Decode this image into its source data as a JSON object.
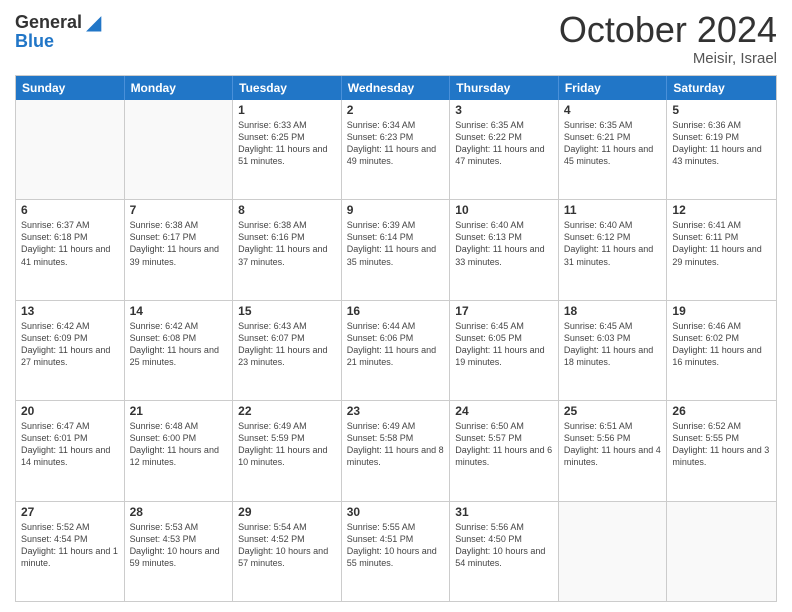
{
  "header": {
    "logo_general": "General",
    "logo_blue": "Blue",
    "month_title": "October 2024",
    "location": "Meisir, Israel"
  },
  "days_of_week": [
    "Sunday",
    "Monday",
    "Tuesday",
    "Wednesday",
    "Thursday",
    "Friday",
    "Saturday"
  ],
  "weeks": [
    [
      {
        "day": "",
        "sunrise": "",
        "sunset": "",
        "daylight": "",
        "empty": true
      },
      {
        "day": "",
        "sunrise": "",
        "sunset": "",
        "daylight": "",
        "empty": true
      },
      {
        "day": "1",
        "sunrise": "Sunrise: 6:33 AM",
        "sunset": "Sunset: 6:25 PM",
        "daylight": "Daylight: 11 hours and 51 minutes.",
        "empty": false
      },
      {
        "day": "2",
        "sunrise": "Sunrise: 6:34 AM",
        "sunset": "Sunset: 6:23 PM",
        "daylight": "Daylight: 11 hours and 49 minutes.",
        "empty": false
      },
      {
        "day": "3",
        "sunrise": "Sunrise: 6:35 AM",
        "sunset": "Sunset: 6:22 PM",
        "daylight": "Daylight: 11 hours and 47 minutes.",
        "empty": false
      },
      {
        "day": "4",
        "sunrise": "Sunrise: 6:35 AM",
        "sunset": "Sunset: 6:21 PM",
        "daylight": "Daylight: 11 hours and 45 minutes.",
        "empty": false
      },
      {
        "day": "5",
        "sunrise": "Sunrise: 6:36 AM",
        "sunset": "Sunset: 6:19 PM",
        "daylight": "Daylight: 11 hours and 43 minutes.",
        "empty": false
      }
    ],
    [
      {
        "day": "6",
        "sunrise": "Sunrise: 6:37 AM",
        "sunset": "Sunset: 6:18 PM",
        "daylight": "Daylight: 11 hours and 41 minutes.",
        "empty": false
      },
      {
        "day": "7",
        "sunrise": "Sunrise: 6:38 AM",
        "sunset": "Sunset: 6:17 PM",
        "daylight": "Daylight: 11 hours and 39 minutes.",
        "empty": false
      },
      {
        "day": "8",
        "sunrise": "Sunrise: 6:38 AM",
        "sunset": "Sunset: 6:16 PM",
        "daylight": "Daylight: 11 hours and 37 minutes.",
        "empty": false
      },
      {
        "day": "9",
        "sunrise": "Sunrise: 6:39 AM",
        "sunset": "Sunset: 6:14 PM",
        "daylight": "Daylight: 11 hours and 35 minutes.",
        "empty": false
      },
      {
        "day": "10",
        "sunrise": "Sunrise: 6:40 AM",
        "sunset": "Sunset: 6:13 PM",
        "daylight": "Daylight: 11 hours and 33 minutes.",
        "empty": false
      },
      {
        "day": "11",
        "sunrise": "Sunrise: 6:40 AM",
        "sunset": "Sunset: 6:12 PM",
        "daylight": "Daylight: 11 hours and 31 minutes.",
        "empty": false
      },
      {
        "day": "12",
        "sunrise": "Sunrise: 6:41 AM",
        "sunset": "Sunset: 6:11 PM",
        "daylight": "Daylight: 11 hours and 29 minutes.",
        "empty": false
      }
    ],
    [
      {
        "day": "13",
        "sunrise": "Sunrise: 6:42 AM",
        "sunset": "Sunset: 6:09 PM",
        "daylight": "Daylight: 11 hours and 27 minutes.",
        "empty": false
      },
      {
        "day": "14",
        "sunrise": "Sunrise: 6:42 AM",
        "sunset": "Sunset: 6:08 PM",
        "daylight": "Daylight: 11 hours and 25 minutes.",
        "empty": false
      },
      {
        "day": "15",
        "sunrise": "Sunrise: 6:43 AM",
        "sunset": "Sunset: 6:07 PM",
        "daylight": "Daylight: 11 hours and 23 minutes.",
        "empty": false
      },
      {
        "day": "16",
        "sunrise": "Sunrise: 6:44 AM",
        "sunset": "Sunset: 6:06 PM",
        "daylight": "Daylight: 11 hours and 21 minutes.",
        "empty": false
      },
      {
        "day": "17",
        "sunrise": "Sunrise: 6:45 AM",
        "sunset": "Sunset: 6:05 PM",
        "daylight": "Daylight: 11 hours and 19 minutes.",
        "empty": false
      },
      {
        "day": "18",
        "sunrise": "Sunrise: 6:45 AM",
        "sunset": "Sunset: 6:03 PM",
        "daylight": "Daylight: 11 hours and 18 minutes.",
        "empty": false
      },
      {
        "day": "19",
        "sunrise": "Sunrise: 6:46 AM",
        "sunset": "Sunset: 6:02 PM",
        "daylight": "Daylight: 11 hours and 16 minutes.",
        "empty": false
      }
    ],
    [
      {
        "day": "20",
        "sunrise": "Sunrise: 6:47 AM",
        "sunset": "Sunset: 6:01 PM",
        "daylight": "Daylight: 11 hours and 14 minutes.",
        "empty": false
      },
      {
        "day": "21",
        "sunrise": "Sunrise: 6:48 AM",
        "sunset": "Sunset: 6:00 PM",
        "daylight": "Daylight: 11 hours and 12 minutes.",
        "empty": false
      },
      {
        "day": "22",
        "sunrise": "Sunrise: 6:49 AM",
        "sunset": "Sunset: 5:59 PM",
        "daylight": "Daylight: 11 hours and 10 minutes.",
        "empty": false
      },
      {
        "day": "23",
        "sunrise": "Sunrise: 6:49 AM",
        "sunset": "Sunset: 5:58 PM",
        "daylight": "Daylight: 11 hours and 8 minutes.",
        "empty": false
      },
      {
        "day": "24",
        "sunrise": "Sunrise: 6:50 AM",
        "sunset": "Sunset: 5:57 PM",
        "daylight": "Daylight: 11 hours and 6 minutes.",
        "empty": false
      },
      {
        "day": "25",
        "sunrise": "Sunrise: 6:51 AM",
        "sunset": "Sunset: 5:56 PM",
        "daylight": "Daylight: 11 hours and 4 minutes.",
        "empty": false
      },
      {
        "day": "26",
        "sunrise": "Sunrise: 6:52 AM",
        "sunset": "Sunset: 5:55 PM",
        "daylight": "Daylight: 11 hours and 3 minutes.",
        "empty": false
      }
    ],
    [
      {
        "day": "27",
        "sunrise": "Sunrise: 5:52 AM",
        "sunset": "Sunset: 4:54 PM",
        "daylight": "Daylight: 11 hours and 1 minute.",
        "empty": false
      },
      {
        "day": "28",
        "sunrise": "Sunrise: 5:53 AM",
        "sunset": "Sunset: 4:53 PM",
        "daylight": "Daylight: 10 hours and 59 minutes.",
        "empty": false
      },
      {
        "day": "29",
        "sunrise": "Sunrise: 5:54 AM",
        "sunset": "Sunset: 4:52 PM",
        "daylight": "Daylight: 10 hours and 57 minutes.",
        "empty": false
      },
      {
        "day": "30",
        "sunrise": "Sunrise: 5:55 AM",
        "sunset": "Sunset: 4:51 PM",
        "daylight": "Daylight: 10 hours and 55 minutes.",
        "empty": false
      },
      {
        "day": "31",
        "sunrise": "Sunrise: 5:56 AM",
        "sunset": "Sunset: 4:50 PM",
        "daylight": "Daylight: 10 hours and 54 minutes.",
        "empty": false
      },
      {
        "day": "",
        "sunrise": "",
        "sunset": "",
        "daylight": "",
        "empty": true
      },
      {
        "day": "",
        "sunrise": "",
        "sunset": "",
        "daylight": "",
        "empty": true
      }
    ]
  ]
}
